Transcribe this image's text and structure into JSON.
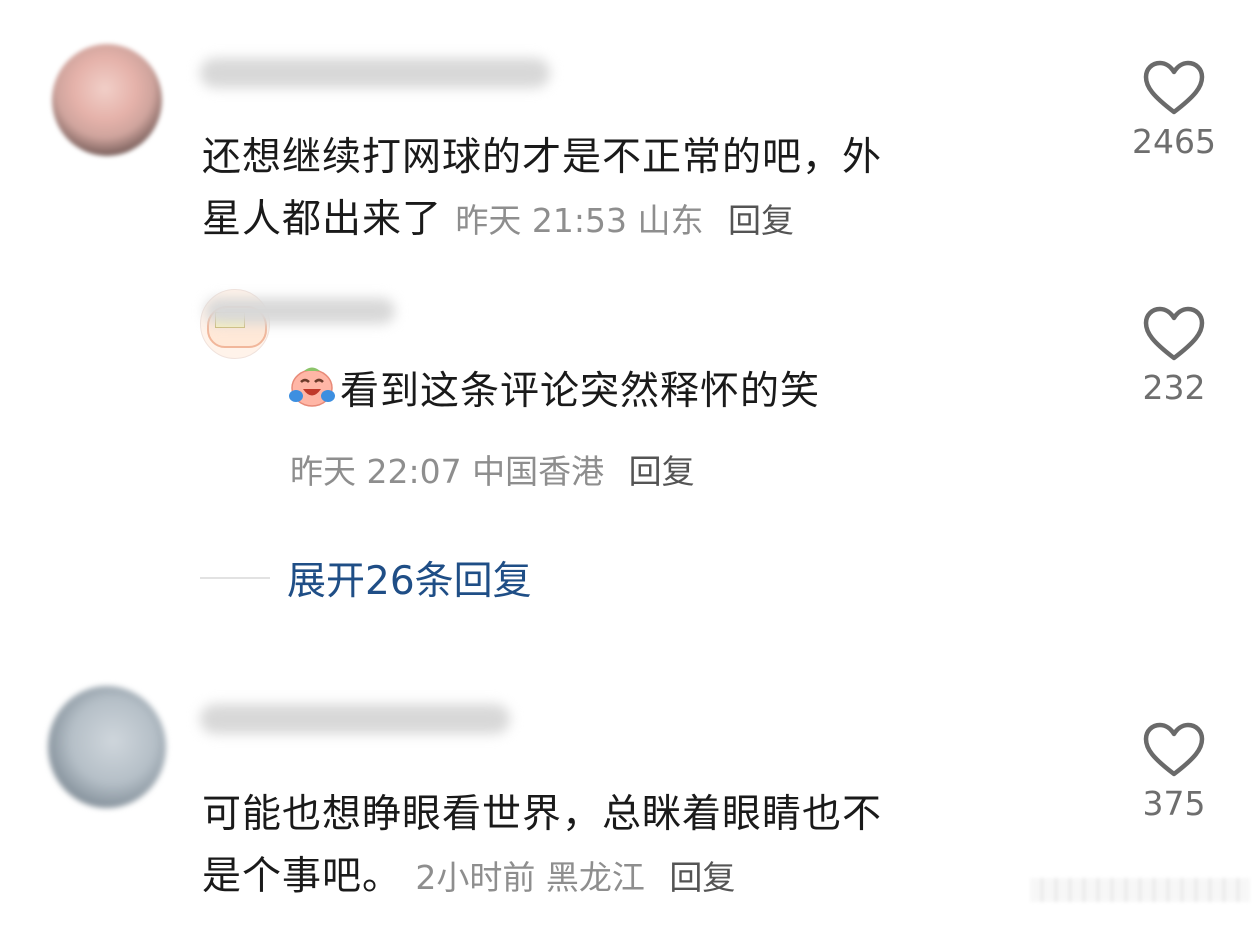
{
  "comments": [
    {
      "text_line1": "还想继续打网球的才是不正常的吧，外",
      "text_line2": "星人都出来了",
      "time": "昨天 21:53",
      "location": "山东",
      "reply_label": "回复",
      "likes": "2465"
    },
    {
      "text_line1": "可能也想睁眼看世界，总眯着眼睛也不",
      "text_line2": "是个事吧。",
      "time": "2小时前",
      "location": "黑龙江",
      "reply_label": "回复",
      "likes": "375"
    }
  ],
  "reply": {
    "text": "看到这条评论突然释怀的笑",
    "time": "昨天 22:07",
    "location": "中国香港",
    "reply_label": "回复",
    "likes": "232"
  },
  "expand_replies": "展开26条回复",
  "colors": {
    "link": "#1f4e86",
    "meta": "#8e8e8e",
    "text": "#1a1a1a"
  },
  "icons": [
    "heart-outline-icon",
    "laughing-crying-emoji"
  ]
}
